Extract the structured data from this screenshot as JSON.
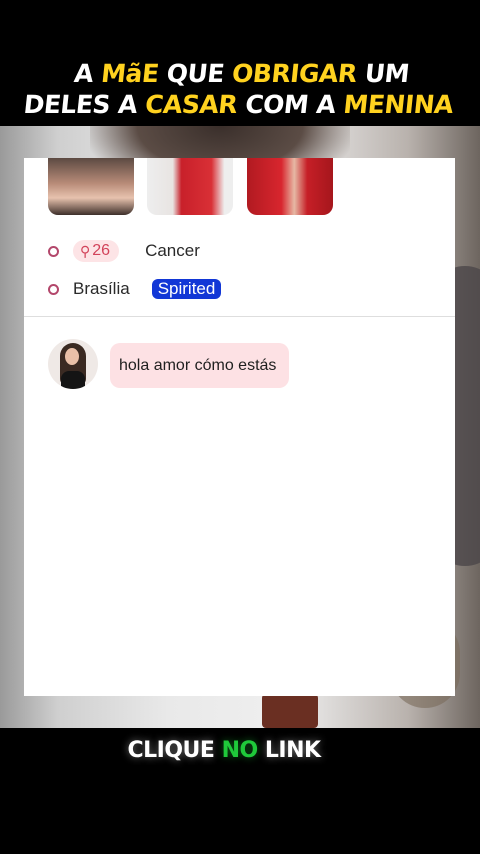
{
  "headline": {
    "line1": [
      {
        "text": "A ",
        "highlight": false
      },
      {
        "text": "MãE",
        "highlight": true
      },
      {
        "text": " QUE ",
        "highlight": false
      },
      {
        "text": "OBRIGAR",
        "highlight": true
      },
      {
        "text": " UM",
        "highlight": false
      }
    ],
    "line2": [
      {
        "text": "DELES A ",
        "highlight": false
      },
      {
        "text": "CASAR",
        "highlight": true
      },
      {
        "text": " COM A ",
        "highlight": false
      },
      {
        "text": "MENINA",
        "highlight": true
      }
    ]
  },
  "profile": {
    "age": "26",
    "age_icon": "search-icon",
    "sign": "Cancer",
    "city": "Brasília",
    "tag": "Spirited"
  },
  "chat": {
    "message": "hola amor cómo estás"
  },
  "cta": {
    "part1": "CLIQUE ",
    "part2": "NO",
    "part3": " LINK"
  },
  "colors": {
    "highlight_yellow": "#ffd21f",
    "cta_green": "#1fc93a",
    "tag_blue": "#1237d6",
    "badge_pink": "#fde4e6",
    "bubble_pink": "#fde1e4"
  }
}
